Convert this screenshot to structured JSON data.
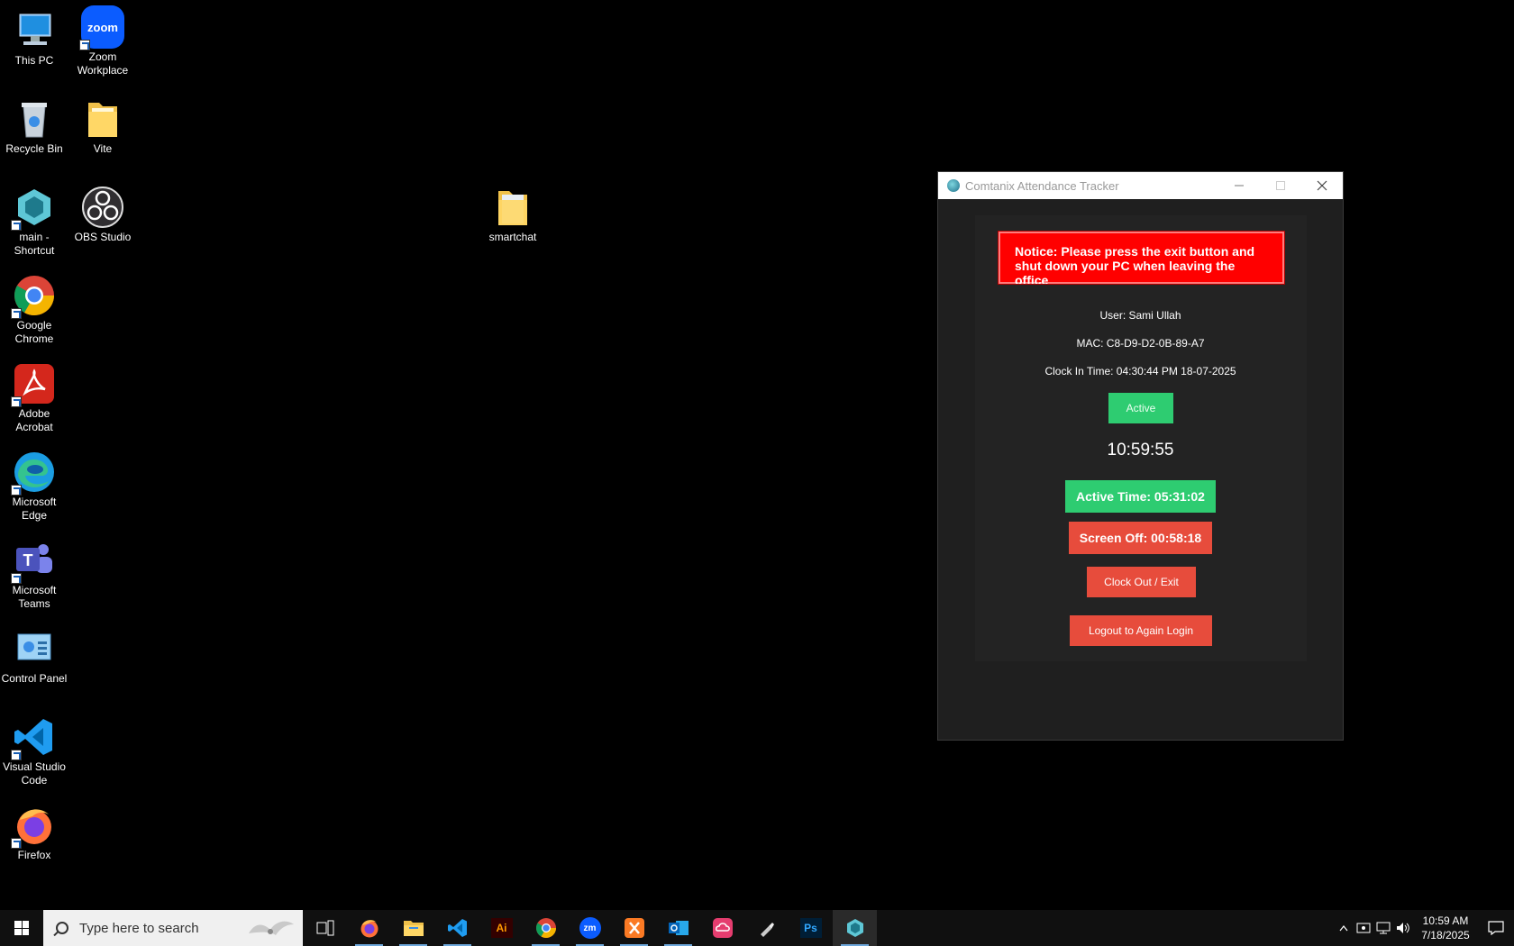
{
  "desktop": {
    "icons": [
      {
        "label": "This PC"
      },
      {
        "label": "Zoom\nWorkplace"
      },
      {
        "label": "Recycle Bin"
      },
      {
        "label": "Vite"
      },
      {
        "label": "main -\nShortcut"
      },
      {
        "label": "OBS Studio"
      },
      {
        "label": "smartchat"
      },
      {
        "label": "Google\nChrome"
      },
      {
        "label": "Adobe\nAcrobat"
      },
      {
        "label": "Microsoft\nEdge"
      },
      {
        "label": "Microsoft\nTeams"
      },
      {
        "label": "Control Panel"
      },
      {
        "label": "Visual Studio\nCode"
      },
      {
        "label": "Firefox"
      }
    ],
    "zoom_logo_text": "zoom"
  },
  "window": {
    "title": "Comtanix Attendance Tracker",
    "notice": "Notice: Please press the exit button and shut down your PC when leaving the office",
    "user": "User: Sami Ullah",
    "mac": "MAC: C8-D9-D2-0B-89-A7",
    "clock_in": "Clock In Time: 04:30:44 PM 18-07-2025",
    "status": "Active",
    "current_time": "10:59:55",
    "active_time": "Active Time: 05:31:02",
    "screen_off": "Screen Off: 00:58:18",
    "clock_out_label": "Clock Out / Exit",
    "logout_label": "Logout to Again Login",
    "colors": {
      "notice_bg": "#ff0000",
      "green": "#2ecc71",
      "red": "#e74c3c",
      "panel": "#1f1f1f"
    }
  },
  "taskbar": {
    "search_placeholder": "Type here to search",
    "time": "10:59 AM",
    "date": "7/18/2025",
    "apps": [
      "task-view",
      "firefox",
      "file-explorer",
      "vscode",
      "illustrator",
      "chrome",
      "zoom",
      "xampp",
      "outlook",
      "creative-cloud",
      "pen-tool",
      "photoshop",
      "attendance-tracker"
    ],
    "zm_label": "zm",
    "ai_label": "Ai",
    "ps_label": "Ps"
  }
}
